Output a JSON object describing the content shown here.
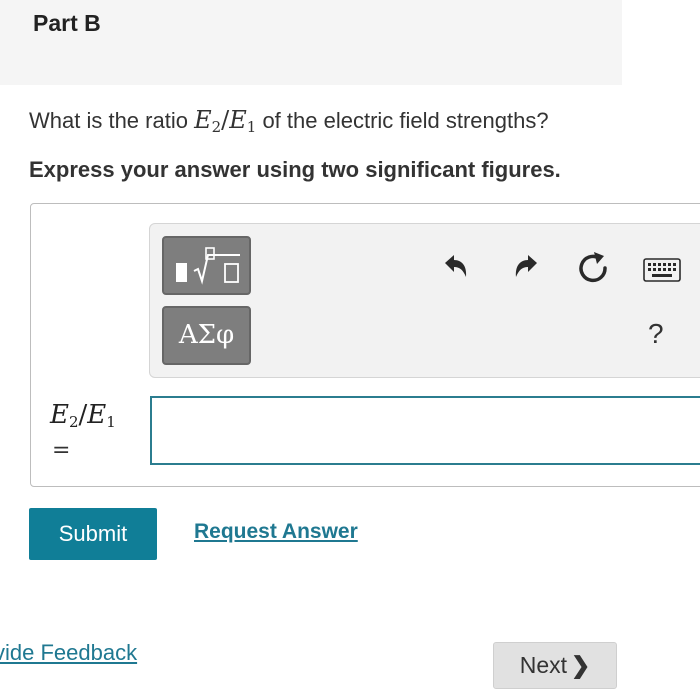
{
  "header": {
    "part_title": "Part B"
  },
  "question": {
    "prefix": "What is the ratio ",
    "ratio": {
      "num_var": "E",
      "num_sub": "2",
      "slash": "/",
      "den_var": "E",
      "den_sub": "1"
    },
    "suffix": " of the electric field strengths?"
  },
  "instruction": "Express your answer using two significant figures.",
  "toolbar": {
    "templates_icon": "templates-sqrt-icon",
    "symbols_label": "ΑΣφ",
    "undo_icon": "undo-icon",
    "redo_icon": "redo-icon",
    "reset_icon": "reset-icon",
    "keyboard_icon": "keyboard-icon",
    "help_label": "?"
  },
  "answer": {
    "label": {
      "num_var": "E",
      "num_sub": "2",
      "slash": "/",
      "den_var": "E",
      "den_sub": "1",
      "equals": "="
    },
    "value": "",
    "placeholder": ""
  },
  "actions": {
    "submit_label": "Submit",
    "request_answer_label": "Request Answer"
  },
  "footer": {
    "feedback_label": "vide Feedback",
    "next_label": "Next",
    "next_icon": "chevron-right-icon"
  },
  "colors": {
    "accent": "#107e97",
    "link": "#1f7891",
    "input_border": "#2b7d8f",
    "tool_button": "#7e7e7e"
  }
}
